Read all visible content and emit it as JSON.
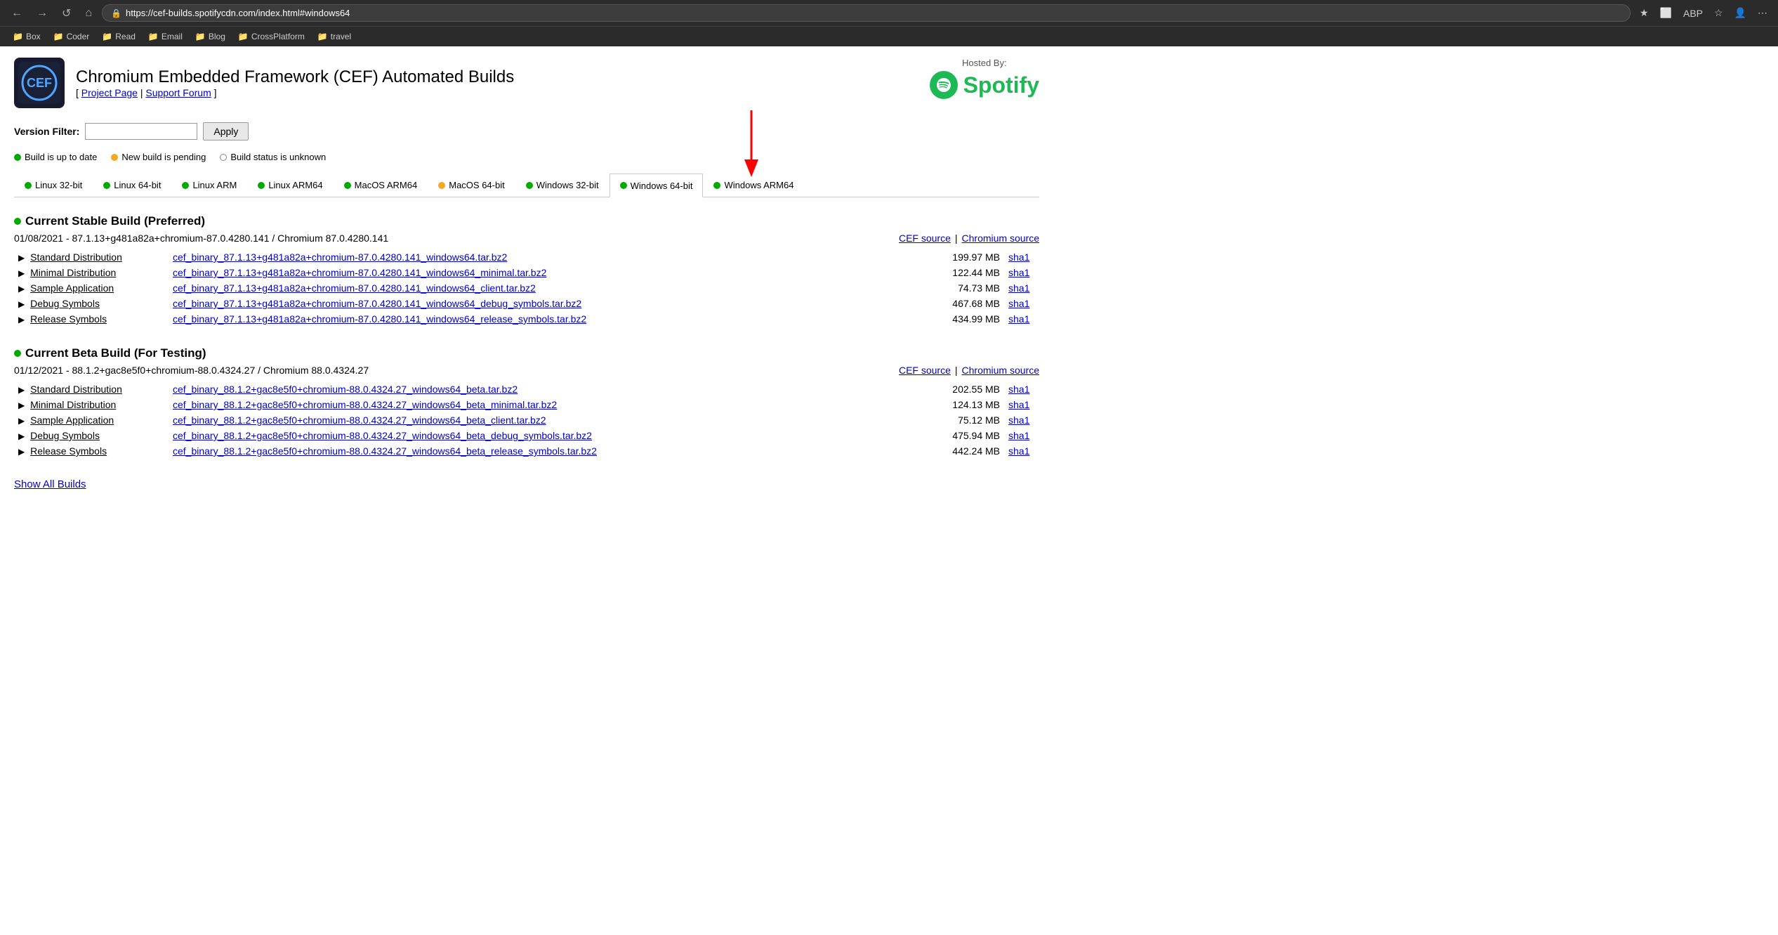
{
  "browser": {
    "back_label": "←",
    "forward_label": "→",
    "refresh_label": "↺",
    "home_label": "⌂",
    "url": "https://cef-builds.spotifycdn.com/index.html#windows64",
    "star_label": "★",
    "menu_label": "⋯"
  },
  "bookmarks": [
    {
      "label": "Box",
      "icon": "📁"
    },
    {
      "label": "Coder",
      "icon": "📁"
    },
    {
      "label": "Read",
      "icon": "📁"
    },
    {
      "label": "Email",
      "icon": "📁"
    },
    {
      "label": "Blog",
      "icon": "📁"
    },
    {
      "label": "CrossPlatform",
      "icon": "📁"
    },
    {
      "label": "travel",
      "icon": "📁"
    }
  ],
  "header": {
    "logo_text": "CEF",
    "title": "Chromium Embedded Framework (CEF) Automated Builds",
    "nav": {
      "bracket_open": "[",
      "project_page": "Project Page",
      "separator": "|",
      "support_forum": "Support Forum",
      "bracket_close": "]"
    }
  },
  "hosted_by": {
    "label": "Hosted By:",
    "name": "Spotify"
  },
  "version_filter": {
    "label": "Version Filter:",
    "placeholder": "",
    "button_label": "Apply"
  },
  "status_legend": [
    {
      "color": "green",
      "text": "Build is up to date"
    },
    {
      "color": "orange",
      "text": "New build is pending"
    },
    {
      "color": "empty",
      "text": "Build status is unknown"
    }
  ],
  "platform_tabs": [
    {
      "label": "Linux 32-bit",
      "dot": "green",
      "active": false
    },
    {
      "label": "Linux 64-bit",
      "dot": "green",
      "active": false
    },
    {
      "label": "Linux ARM",
      "dot": "green",
      "active": false
    },
    {
      "label": "Linux ARM64",
      "dot": "green",
      "active": false
    },
    {
      "label": "MacOS ARM64",
      "dot": "green",
      "active": false
    },
    {
      "label": "MacOS 64-bit",
      "dot": "orange",
      "active": false
    },
    {
      "label": "Windows 32-bit",
      "dot": "green",
      "active": false
    },
    {
      "label": "Windows 64-bit",
      "dot": "green",
      "active": true
    },
    {
      "label": "Windows ARM64",
      "dot": "green",
      "active": false
    }
  ],
  "stable_build": {
    "title": "Current Stable Build (Preferred)",
    "version_line": "01/08/2021 - 87.1.13+g481a82a+chromium-87.0.4280.141 / Chromium 87.0.4280.141",
    "cef_source_label": "CEF source",
    "separator": "|",
    "chromium_source_label": "Chromium source",
    "rows": [
      {
        "label": "Standard Distribution",
        "file": "cef_binary_87.1.13+g481a82a+chromium-87.0.4280.141_windows64.tar.bz2",
        "size": "199.97 MB",
        "hash": "sha1"
      },
      {
        "label": "Minimal Distribution",
        "file": "cef_binary_87.1.13+g481a82a+chromium-87.0.4280.141_windows64_minimal.tar.bz2",
        "size": "122.44 MB",
        "hash": "sha1"
      },
      {
        "label": "Sample Application",
        "file": "cef_binary_87.1.13+g481a82a+chromium-87.0.4280.141_windows64_client.tar.bz2",
        "size": "74.73 MB",
        "hash": "sha1"
      },
      {
        "label": "Debug Symbols",
        "file": "cef_binary_87.1.13+g481a82a+chromium-87.0.4280.141_windows64_debug_symbols.tar.bz2",
        "size": "467.68 MB",
        "hash": "sha1"
      },
      {
        "label": "Release Symbols",
        "file": "cef_binary_87.1.13+g481a82a+chromium-87.0.4280.141_windows64_release_symbols.tar.bz2",
        "size": "434.99 MB",
        "hash": "sha1"
      }
    ]
  },
  "beta_build": {
    "title": "Current Beta Build (For Testing)",
    "version_line": "01/12/2021 - 88.1.2+gac8e5f0+chromium-88.0.4324.27 / Chromium 88.0.4324.27",
    "cef_source_label": "CEF source",
    "separator": "|",
    "chromium_source_label": "Chromium source",
    "rows": [
      {
        "label": "Standard Distribution",
        "file": "cef_binary_88.1.2+gac8e5f0+chromium-88.0.4324.27_windows64_beta.tar.bz2",
        "size": "202.55 MB",
        "hash": "sha1"
      },
      {
        "label": "Minimal Distribution",
        "file": "cef_binary_88.1.2+gac8e5f0+chromium-88.0.4324.27_windows64_beta_minimal.tar.bz2",
        "size": "124.13 MB",
        "hash": "sha1"
      },
      {
        "label": "Sample Application",
        "file": "cef_binary_88.1.2+gac8e5f0+chromium-88.0.4324.27_windows64_beta_client.tar.bz2",
        "size": "75.12 MB",
        "hash": "sha1"
      },
      {
        "label": "Debug Symbols",
        "file": "cef_binary_88.1.2+gac8e5f0+chromium-88.0.4324.27_windows64_beta_debug_symbols.tar.bz2",
        "size": "475.94 MB",
        "hash": "sha1"
      },
      {
        "label": "Release Symbols",
        "file": "cef_binary_88.1.2+gac8e5f0+chromium-88.0.4324.27_windows64_beta_release_symbols.tar.bz2",
        "size": "442.24 MB",
        "hash": "sha1"
      }
    ]
  },
  "show_all_label": "Show All Builds"
}
